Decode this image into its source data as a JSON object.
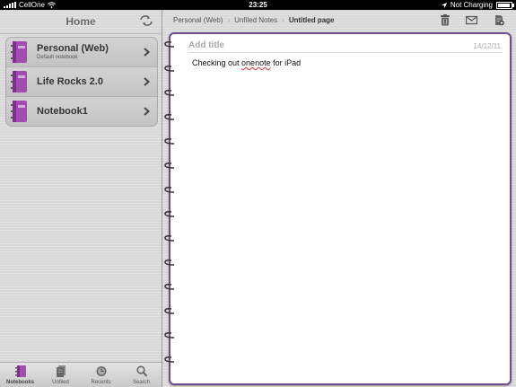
{
  "status_bar": {
    "carrier": "CellOne",
    "time": "23:25",
    "battery_text": "Not Charging"
  },
  "sidebar": {
    "title": "Home",
    "notebooks": [
      {
        "name": "Personal (Web)",
        "subtitle": "Default notebook"
      },
      {
        "name": "Life Rocks 2.0"
      },
      {
        "name": "Notebook1"
      }
    ],
    "tabs": [
      {
        "label": "Notebooks",
        "icon": "notebooks-icon",
        "active": true
      },
      {
        "label": "Unfiled",
        "icon": "unfiled-icon"
      },
      {
        "label": "Recents",
        "icon": "recents-icon"
      },
      {
        "label": "Search",
        "icon": "search-icon"
      }
    ]
  },
  "breadcrumb": [
    "Personal (Web)",
    "Unfiled Notes",
    "Untitled page"
  ],
  "page": {
    "title_placeholder": "Add title",
    "date": "14/12/11",
    "body_before": "Checking out ",
    "body_misspelled": "onenote",
    "body_after": " for iPad"
  },
  "colors": {
    "accent": "#6d4f8c",
    "notebook_icon": "#b05db8"
  }
}
